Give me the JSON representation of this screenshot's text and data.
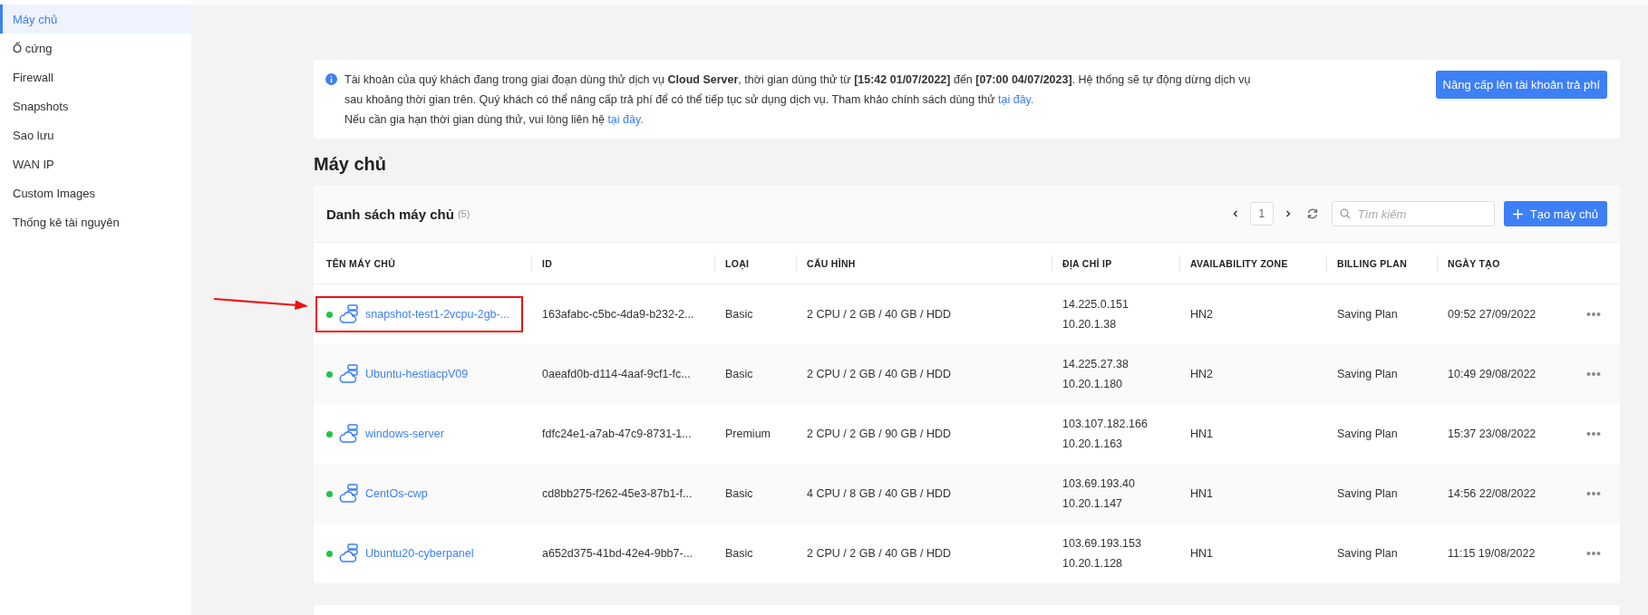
{
  "sidebar": {
    "items": [
      {
        "label": "Máy chủ",
        "selected": true
      },
      {
        "label": "Ổ cứng",
        "selected": false
      },
      {
        "label": "Firewall",
        "selected": false
      },
      {
        "label": "Snapshots",
        "selected": false
      },
      {
        "label": "Sao lưu",
        "selected": false
      },
      {
        "label": "WAN IP",
        "selected": false
      },
      {
        "label": "Custom Images",
        "selected": false
      },
      {
        "label": "Thống kê tài nguyên",
        "selected": false
      }
    ]
  },
  "notice": {
    "lines": [
      {
        "text": "Tài khoản của quý khách đang trong giai đoạn dùng thử dịch vụ **Cloud Server**, thời gian dùng thử từ **[15:42 01/07/2022]** đến **[07:00 04/07/2023]**. Hệ thống sẽ tự động dừng dịch vụ sau khoảng thời gian trên. Quý khách có thể nâng cấp trả phí để có thể tiếp tục sử dụng dịch vụ. Tham khảo chính sách dùng thử",
        "link": "tại đây."
      },
      {
        "text": "Nếu cần gia hạn thời gian dùng thử, vui lòng liên hệ",
        "link": "tại đây."
      }
    ],
    "button": "Nâng cấp lên tài khoản trả phí"
  },
  "page_title": "Máy chủ",
  "server_list": {
    "title": "Danh sách máy chủ",
    "count": "(5)",
    "page": "1",
    "search": {
      "placeholder": "Tìm kiếm"
    },
    "create_button": "Tạo máy chủ",
    "columns": [
      "TÊN MÁY CHỦ",
      "ID",
      "LOẠI",
      "CẤU HÌNH",
      "ĐỊA CHỈ IP",
      "AVAILABILITY ZONE",
      "BILLING PLAN",
      "NGÀY TẠO"
    ],
    "rows": [
      {
        "name": "snapshot-test1-2vcpu-2gb-...",
        "highlighted": true,
        "id": "163afabc-c5bc-4da9-b232-2...",
        "type": "Basic",
        "config": "2 CPU / 2 GB / 40 GB / HDD",
        "ips": [
          "14.225.0.151",
          "10.20.1.38"
        ],
        "zone": "HN2",
        "billing": "Saving Plan",
        "created": "09:52 27/09/2022"
      },
      {
        "name": "Ubuntu-hestiacpV09",
        "highlighted": false,
        "id": "0aeafd0b-d114-4aaf-9cf1-fc...",
        "type": "Basic",
        "config": "2 CPU / 2 GB / 40 GB / HDD",
        "ips": [
          "14.225.27.38",
          "10.20.1.180"
        ],
        "zone": "HN2",
        "billing": "Saving Plan",
        "created": "10:49 29/08/2022"
      },
      {
        "name": "windows-server",
        "highlighted": false,
        "id": "fdfc24e1-a7ab-47c9-8731-1...",
        "type": "Premium",
        "config": "2 CPU / 2 GB / 90 GB / HDD",
        "ips": [
          "103.107.182.166",
          "10.20.1.163"
        ],
        "zone": "HN1",
        "billing": "Saving Plan",
        "created": "15:37 23/08/2022"
      },
      {
        "name": "CentOs-cwp",
        "highlighted": false,
        "id": "cd8bb275-f262-45e3-87b1-f...",
        "type": "Basic",
        "config": "4 CPU / 8 GB / 40 GB / HDD",
        "ips": [
          "103.69.193.40",
          "10.20.1.147"
        ],
        "zone": "HN1",
        "billing": "Saving Plan",
        "created": "14:56 22/08/2022"
      },
      {
        "name": "Ubuntu20-cyberpanel",
        "highlighted": false,
        "id": "a652d375-41bd-42e4-9bb7-...",
        "type": "Basic",
        "config": "2 CPU / 2 GB / 40 GB / HDD",
        "ips": [
          "103.69.193.153",
          "10.20.1.128"
        ],
        "zone": "HN1",
        "billing": "Saving Plan",
        "created": "11:15 19/08/2022"
      }
    ]
  }
}
